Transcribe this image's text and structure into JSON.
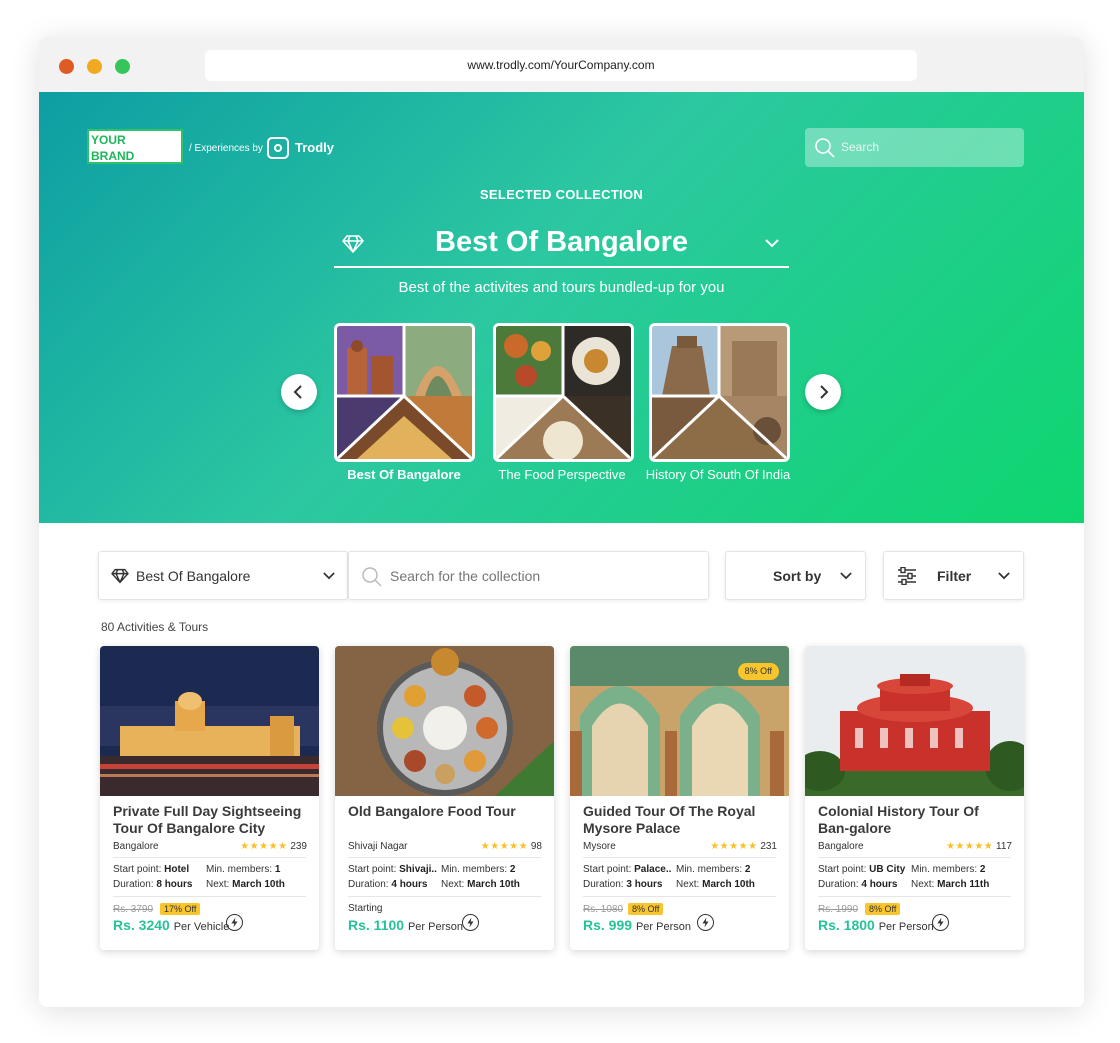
{
  "browser": {
    "url": "www.trodly.com/YourCompany.com"
  },
  "header": {
    "brand_text": "YOUR BRAND",
    "experiences_by": "/ Experiences by",
    "trodly": "Trodly",
    "search_placeholder": "Search"
  },
  "hero": {
    "selected_label": "SELECTED COLLECTION",
    "collection_title": "Best Of Bangalore",
    "subtitle": "Best of the activites and tours bundled-up for you",
    "collections": [
      {
        "label": "Best Of Bangalore",
        "active": true
      },
      {
        "label": "The Food Perspective",
        "active": false
      },
      {
        "label": "History Of South Of India",
        "active": false
      }
    ]
  },
  "filters": {
    "collection": "Best Of Bangalore",
    "search_placeholder": "Search for the collection",
    "sort_label": "Sort by",
    "filter_label": "Filter"
  },
  "results_count": "80 Activities & Tours",
  "cards": [
    {
      "title": "Private Full Day Sightseeing Tour Of Bangalore City",
      "location": "Bangalore",
      "rating": 5,
      "reviews": "239",
      "start_label": "Start point:",
      "start": "Hotel",
      "min_label": "Min. members:",
      "min": "1",
      "duration_label": "Duration:",
      "duration": "8 hours",
      "next_label": "Next:",
      "next": "March 10th",
      "old_price": "Rs. 3790",
      "discount": "17% Off",
      "price": "Rs. 3240",
      "per": "Per Vehicle"
    },
    {
      "title": "Old Bangalore Food Tour",
      "location": "Shivaji Nagar",
      "rating": 5,
      "reviews": "98",
      "start_label": "Start point:",
      "start": "Shivaji..",
      "min_label": "Min. members:",
      "min": "2",
      "duration_label": "Duration:",
      "duration": "4 hours",
      "next_label": "Next:",
      "next": "March 10th",
      "starting": "Starting",
      "price": "Rs. 1100",
      "per": "Per Person"
    },
    {
      "title": "Guided Tour Of The Royal Mysore Palace",
      "location": "Mysore",
      "rating": 5,
      "reviews": "231",
      "start_label": "Start point:",
      "start": "Palace..",
      "min_label": "Min. members:",
      "min": "2",
      "duration_label": "Duration:",
      "duration": "3 hours",
      "next_label": "Next:",
      "next": "March 10th",
      "old_price": "Rs. 1080",
      "discount": "8% Off",
      "image_badge": "8% Off",
      "price": "Rs. 999",
      "per": "Per Person"
    },
    {
      "title": "Colonial History Tour Of Ban-galore",
      "location": "Bangalore",
      "rating": 5,
      "reviews": "117",
      "start_label": "Start point:",
      "start": "UB City",
      "min_label": "Min. members:",
      "min": "2",
      "duration_label": "Duration:",
      "duration": "4 hours",
      "next_label": "Next:",
      "next": "March 11th",
      "old_price": "Rs. 1990",
      "discount": "8% Off",
      "price": "Rs. 1800",
      "per": "Per Person"
    }
  ],
  "stars_text": "★★★★★",
  "colors": {
    "accent": "#27c19a",
    "badge": "#f8c52d",
    "hero_start": "#0d9ea3",
    "hero_end": "#0ed66e"
  }
}
